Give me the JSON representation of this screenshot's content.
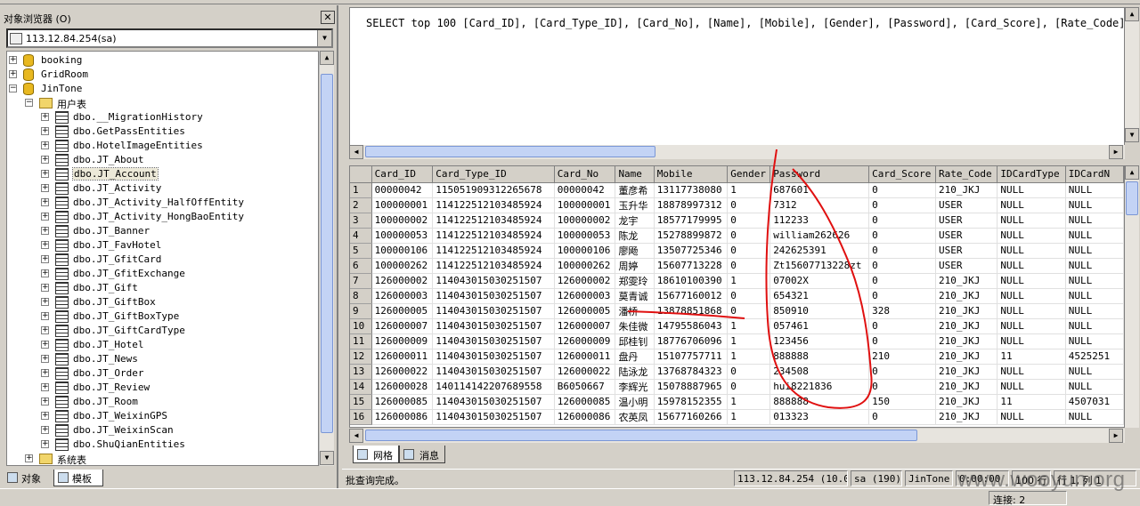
{
  "object_browser": {
    "title": "对象浏览器 (O)",
    "close_label": "✕",
    "server": "113.12.84.254(sa)",
    "databases": [
      "booking",
      "GridRoom",
      "JinTone"
    ],
    "user_tables_folder": "用户表",
    "tables": [
      "dbo.__MigrationHistory",
      "dbo.GetPassEntities",
      "dbo.HotelImageEntities",
      "dbo.JT_About",
      "dbo.JT_Account",
      "dbo.JT_Activity",
      "dbo.JT_Activity_HalfOffEntity",
      "dbo.JT_Activity_HongBaoEntity",
      "dbo.JT_Banner",
      "dbo.JT_FavHotel",
      "dbo.JT_GfitCard",
      "dbo.JT_GfitExchange",
      "dbo.JT_Gift",
      "dbo.JT_GiftBox",
      "dbo.JT_GiftBoxType",
      "dbo.JT_GiftCardType",
      "dbo.JT_Hotel",
      "dbo.JT_News",
      "dbo.JT_Order",
      "dbo.JT_Review",
      "dbo.JT_Room",
      "dbo.JT_WeixinGPS",
      "dbo.JT_WeixinScan",
      "dbo.ShuQianEntities"
    ],
    "system_tables_folder": "系统表",
    "tabs": [
      "对象",
      "模板"
    ]
  },
  "editor": {
    "sql": "SELECT top 100 [Card_ID], [Card_Type_ID], [Card_No], [Name], [Mobile], [Gender], [Password], [Card_Score], [Rate_Code], [I"
  },
  "grid": {
    "columns": [
      "Card_ID",
      "Card_Type_ID",
      "Card_No",
      "Name",
      "Mobile",
      "Gender",
      "Password",
      "Card_Score",
      "Rate_Code",
      "IDCardType",
      "IDCardN"
    ],
    "rows": [
      [
        "1",
        "00000042",
        "115051909312265678",
        "00000042",
        "董彦希",
        "13117738080",
        "1",
        "687601",
        "0",
        "210_JKJ",
        "NULL",
        "NULL"
      ],
      [
        "2",
        "100000001",
        "114122512103485924",
        "100000001",
        "玉升华",
        "18878997312",
        "0",
        "7312",
        "0",
        "USER",
        "NULL",
        "NULL"
      ],
      [
        "3",
        "100000002",
        "114122512103485924",
        "100000002",
        "龙宇",
        "18577179995",
        "0",
        "112233",
        "0",
        "USER",
        "NULL",
        "NULL"
      ],
      [
        "4",
        "100000053",
        "114122512103485924",
        "100000053",
        "陈龙",
        "15278899872",
        "0",
        "william262626",
        "0",
        "USER",
        "NULL",
        "NULL"
      ],
      [
        "5",
        "100000106",
        "114122512103485924",
        "100000106",
        "廖飏",
        "13507725346",
        "0",
        "242625391",
        "0",
        "USER",
        "NULL",
        "NULL"
      ],
      [
        "6",
        "100000262",
        "114122512103485924",
        "100000262",
        "周婷",
        "15607713228",
        "0",
        "Zt15607713228zt",
        "0",
        "USER",
        "NULL",
        "NULL"
      ],
      [
        "7",
        "126000002",
        "114043015030251507",
        "126000002",
        "郑雯玲",
        "18610100390",
        "1",
        "07002X",
        "0",
        "210_JKJ",
        "NULL",
        "NULL"
      ],
      [
        "8",
        "126000003",
        "114043015030251507",
        "126000003",
        "莫青诚",
        "15677160012",
        "0",
        "654321",
        "0",
        "210_JKJ",
        "NULL",
        "NULL"
      ],
      [
        "9",
        "126000005",
        "114043015030251507",
        "126000005",
        "潘桥",
        "13878851868",
        "0",
        "850910",
        "328",
        "210_JKJ",
        "NULL",
        "NULL"
      ],
      [
        "10",
        "126000007",
        "114043015030251507",
        "126000007",
        "朱佳微",
        "14795586043",
        "1",
        "057461",
        "0",
        "210_JKJ",
        "NULL",
        "NULL"
      ],
      [
        "11",
        "126000009",
        "114043015030251507",
        "126000009",
        "邱桂钊",
        "18776706096",
        "1",
        "123456",
        "0",
        "210_JKJ",
        "NULL",
        "NULL"
      ],
      [
        "12",
        "126000011",
        "114043015030251507",
        "126000011",
        "盘丹",
        "15107757711",
        "1",
        "888888",
        "210",
        "210_JKJ",
        "11",
        "4525251"
      ],
      [
        "13",
        "126000022",
        "114043015030251507",
        "126000022",
        "陆泳龙",
        "13768784323",
        "0",
        "234508",
        "0",
        "210_JKJ",
        "NULL",
        "NULL"
      ],
      [
        "14",
        "126000028",
        "140114142207689558",
        "B6050667",
        "李辉光",
        "15078887965",
        "0",
        "hui8221836",
        "0",
        "210_JKJ",
        "NULL",
        "NULL"
      ],
      [
        "15",
        "126000085",
        "114043015030251507",
        "126000085",
        "温小明",
        "15978152355",
        "1",
        "888888",
        "150",
        "210_JKJ",
        "11",
        "4507031"
      ],
      [
        "16",
        "126000086",
        "114043015030251507",
        "126000086",
        "农英凤",
        "15677160266",
        "1",
        "013323",
        "0",
        "210_JKJ",
        "NULL",
        "NULL"
      ]
    ]
  },
  "result_tabs": [
    "网格",
    "消息"
  ],
  "statusbar": {
    "message": "批查询完成。",
    "server": "113.12.84.254 (10.0)",
    "login": "sa (190)",
    "database": "JinTone",
    "elapsed": "0:00:00",
    "rows": "100 行",
    "position": "行 1, 列 1"
  },
  "app_status": {
    "connections": "连接: 2"
  },
  "watermark": "www.wooyun.org",
  "colors": {
    "annotation": "#e01010",
    "selection": "#ece9d8",
    "chrome": "#d4d0c8"
  }
}
